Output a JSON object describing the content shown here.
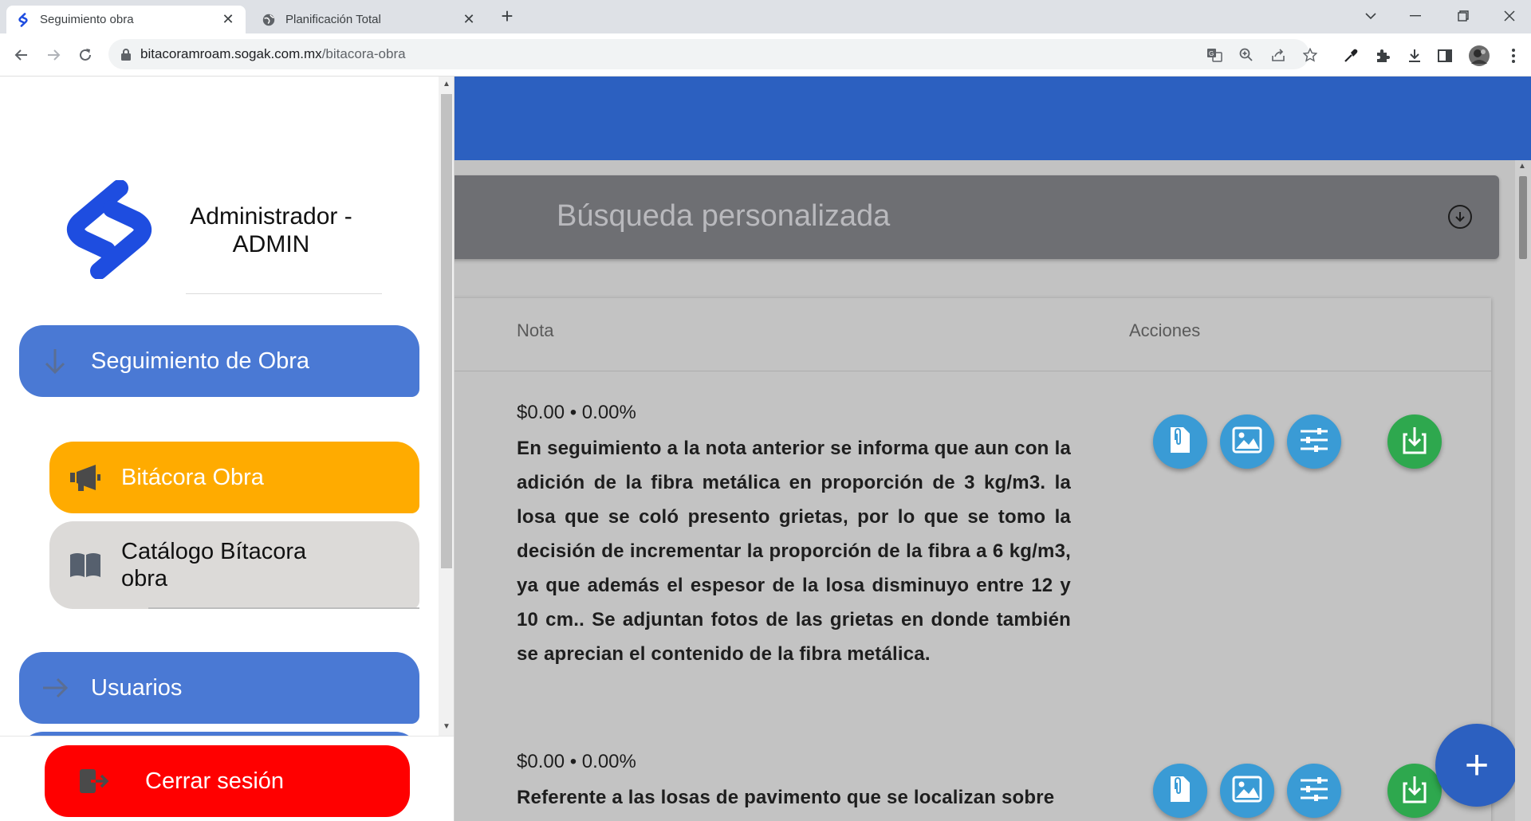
{
  "browser": {
    "tabs": [
      {
        "title": "Seguimiento obra",
        "active": true,
        "icon": "sogak-logo-icon"
      },
      {
        "title": "Planificación Total",
        "active": false,
        "icon": "globe-icon"
      }
    ],
    "new_tab_symbol": "+",
    "url_host": "bitacoramroam.sogak.com.mx",
    "url_path": "/bitacora-obra",
    "window_controls": [
      "chevron-down-icon",
      "minimize-icon",
      "restore-icon",
      "close-icon"
    ]
  },
  "drawer": {
    "user_name": "Administrador - ADMIN",
    "menu": [
      {
        "label": "Seguimiento de Obra",
        "icon": "arrow-down-icon",
        "color": "#4a79d4"
      },
      {
        "label": "Bitácora Obra",
        "icon": "megaphone-icon",
        "color": "#ffab00"
      },
      {
        "label": "Catálogo Bítacora obra",
        "icon": "book-icon",
        "color": "#dcdad8"
      },
      {
        "label": "Usuarios",
        "icon": "arrow-right-icon",
        "color": "#4a79d4"
      }
    ],
    "logout_label": "Cerrar sesión",
    "logout_color": "#ff0000"
  },
  "search": {
    "label": "Búsqueda personalizada"
  },
  "table": {
    "columns": [
      "Nota",
      "Acciones"
    ],
    "rows": [
      {
        "amount": "$0.00 • 0.00%",
        "text": "En seguimiento a la nota anterior se informa que aun con la adición de la fibra metálica en proporción de 3 kg/m3. la losa que se coló presento grietas, por lo que se tomo la decisión de incrementar la proporción de la fibra a 6 kg/m3, ya que además el espesor de la losa disminuyo entre 12 y 10 cm.. Se adjuntan fotos de las grietas en donde también se aprecian el contenido de la fibra metálica.",
        "actions": [
          "attachment-icon",
          "image-icon",
          "settings-sliders-icon",
          "download-icon"
        ]
      },
      {
        "amount": "$0.00 • 0.00%",
        "text": "Referente a las losas de pavimento que se localizan sobre",
        "actions": [
          "attachment-icon",
          "image-icon",
          "settings-sliders-icon",
          "download-icon"
        ]
      }
    ]
  },
  "fab_symbol": "+",
  "colors": {
    "header_blue": "#2c60c0",
    "action_blue": "#3a9bd5",
    "action_green": "#2ea84e"
  }
}
